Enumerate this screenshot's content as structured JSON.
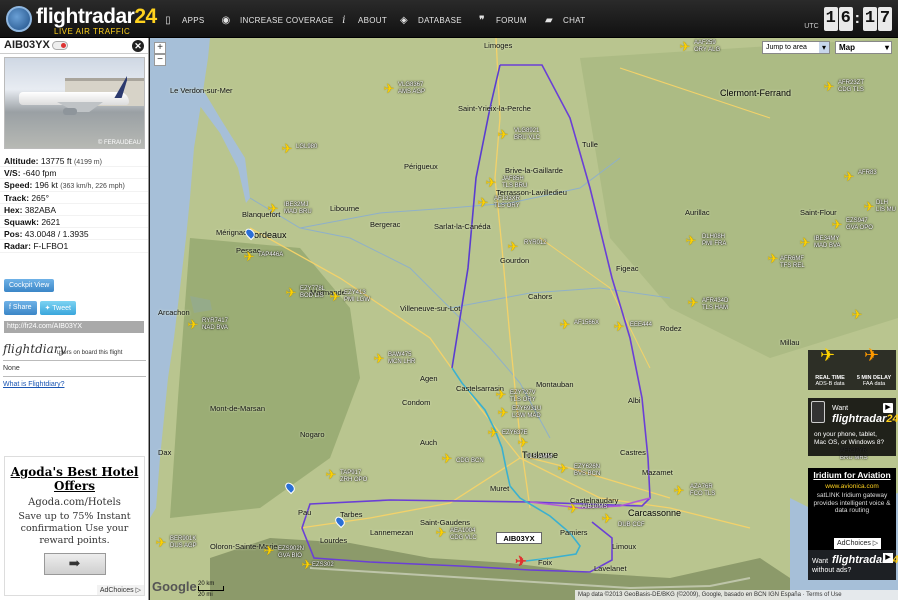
{
  "brand": {
    "name_a": "flightradar",
    "name_b": "24",
    "tagline": "LIVE AIR TRAFFIC"
  },
  "nav": [
    {
      "label": "APPS",
      "icon": "phone-icon"
    },
    {
      "label": "INCREASE COVERAGE",
      "icon": "eye-icon"
    },
    {
      "label": "ABOUT",
      "icon": "info-icon"
    },
    {
      "label": "DATABASE",
      "icon": "database-icon"
    },
    {
      "label": "FORUM",
      "icon": "quote-icon"
    },
    {
      "label": "CHAT",
      "icon": "chat-icon"
    }
  ],
  "clock": {
    "label": "UTC",
    "h1": "1",
    "h2": "6",
    "m1": "1",
    "m2": "7"
  },
  "flight": {
    "callsign": "AIB03YX",
    "photo_credit": "© FERAUDEAU",
    "altitude_label": "Altitude:",
    "altitude": "13775 ft",
    "altitude_m": "(4199 m)",
    "vs_label": "V/S:",
    "vs": "-640 fpm",
    "speed_label": "Speed:",
    "speed": "196 kt",
    "speed_sub": "(363 km/h, 226 mph)",
    "track_label": "Track:",
    "track": "265°",
    "hex_label": "Hex:",
    "hex": "382ABA",
    "squawk_label": "Squawk:",
    "squawk": "2621",
    "pos_label": "Pos:",
    "pos": "43.0048 / 1.3935",
    "radar_label": "Radar:",
    "radar": "F-LFBO1",
    "cockpit_label": "Cockpit View",
    "share_label": "f Share",
    "tweet_label": "Tweet",
    "shortlink": "http://fr24.com/AIB03YX"
  },
  "flightdiary": {
    "logo": "flightdiary",
    "caption": "users on board this flight",
    "none": "None",
    "what": "What is Flightdiary?"
  },
  "ad": {
    "title": "Agoda's Best Hotel Offers",
    "url": "Agoda.com/Hotels",
    "body": "Save up to 75% Instant confirmation Use your reward points.",
    "button": "➡",
    "choices": "AdChoices ▷"
  },
  "map": {
    "jump_label": "Jump to area",
    "type_label": "Map",
    "selected_tag": "AIB03YX",
    "google": "Google",
    "scale_a": "20 km",
    "scale_b": "20 mi",
    "attribution": "Map data ©2013 GeoBasis-DE/BKG (©2009), Google, basado en BCN IGN España · Terms of Use",
    "cities": [
      {
        "n": "Limoges",
        "c": "city"
      },
      {
        "n": "Bordeaux",
        "c": "big"
      },
      {
        "n": "Toulouse",
        "c": "big"
      },
      {
        "n": "Clermont-Ferrand",
        "c": "big"
      },
      {
        "n": "Brive-la-Gaillarde",
        "c": "city"
      },
      {
        "n": "Périgueux",
        "c": "city"
      },
      {
        "n": "Montauban",
        "c": "city"
      },
      {
        "n": "Tarbes",
        "c": "city"
      },
      {
        "n": "Pau",
        "c": "city"
      },
      {
        "n": "Cahors",
        "c": "city"
      },
      {
        "n": "Rodez",
        "c": "city"
      },
      {
        "n": "Albi",
        "c": "city"
      },
      {
        "n": "Castres",
        "c": "city"
      },
      {
        "n": "Foix",
        "c": "city"
      },
      {
        "n": "Aurillac",
        "c": "city"
      },
      {
        "n": "Figeac",
        "c": "city"
      },
      {
        "n": "Mérignac",
        "c": "city"
      },
      {
        "n": "Arcachon",
        "c": "city"
      },
      {
        "n": "Agen",
        "c": "city"
      },
      {
        "n": "Auch",
        "c": "city"
      },
      {
        "n": "Mazamet",
        "c": "city"
      },
      {
        "n": "Lourdes",
        "c": "city"
      },
      {
        "n": "Carcassonne",
        "c": "city"
      },
      {
        "n": "Castelnaudary",
        "c": "city"
      },
      {
        "n": "Gourdon",
        "c": "city"
      },
      {
        "n": "Marmande",
        "c": "city"
      },
      {
        "n": "Bergerac",
        "c": "city"
      },
      {
        "n": "Sarlat-la-Canéda",
        "c": "city"
      },
      {
        "n": "Limoux",
        "c": "city"
      },
      {
        "n": "Millau",
        "c": "city"
      },
      {
        "n": "Saint-Flour",
        "c": "city"
      },
      {
        "n": "Tulle",
        "c": "city"
      },
      {
        "n": "Villeneuve-sur-Lot",
        "c": "city"
      },
      {
        "n": "Castelsarrasin",
        "c": "city"
      },
      {
        "n": "Lannemezan",
        "c": "city"
      },
      {
        "n": "Pamiers",
        "c": "city"
      },
      {
        "n": "Lavelanet",
        "c": "city"
      },
      {
        "n": "Saint-Gaudens",
        "c": "city"
      },
      {
        "n": "Muret",
        "c": "city"
      },
      {
        "n": "Condom",
        "c": "city"
      },
      {
        "n": "Dax",
        "c": "city"
      },
      {
        "n": "Mont-de-Marsan",
        "c": "city"
      },
      {
        "n": "Nogaro",
        "c": "city"
      },
      {
        "n": "Blanquefort",
        "c": "city"
      },
      {
        "n": "Pessac",
        "c": "city"
      },
      {
        "n": "Libourne",
        "c": "city"
      },
      {
        "n": "Saint-Yrieix-la-Perche",
        "c": "city"
      },
      {
        "n": "Terrasson-Lavilledieu",
        "c": "city"
      },
      {
        "n": "Le Verdon-sur-Mer",
        "c": "city"
      },
      {
        "n": "Oloron-Sainte-Marie",
        "c": "city"
      }
    ],
    "planes": [
      {
        "lbl": "VLG8367\nAMS AGP"
      },
      {
        "lbl": "AAF259\nORY ALG"
      },
      {
        "lbl": "AFR23ZT\nCDG TLS"
      },
      {
        "lbl": "LGL980"
      },
      {
        "lbl": "VLG8921\nBRU VLC"
      },
      {
        "lbl": "JAF85H\nTLS BRU"
      },
      {
        "lbl": "AF133XR\nTLS ORY"
      },
      {
        "lbl": "IBE32MJ\nMAD BRU"
      },
      {
        "lbl": "RYR012"
      },
      {
        "lbl": "DLH08H\nPMI FRA"
      },
      {
        "lbl": "IBE34MY\nMAD BVA"
      },
      {
        "lbl": "EZS947\nGVA OPO"
      },
      {
        "lbl": "TAP446A"
      },
      {
        "lbl": "EZY778L\nBOD LIS"
      },
      {
        "lbl": "EZY413\nPMI LGW"
      },
      {
        "lbl": "AFR434D\nTLS HAM"
      },
      {
        "lbl": "RYR7417\nNAD BVA"
      },
      {
        "lbl": "AF1566X"
      },
      {
        "lbl": "EEE444"
      },
      {
        "lbl": "BAW475\nMCN LHR"
      },
      {
        "lbl": "EZY727V\nTLS ORY"
      },
      {
        "lbl": "EZY6931U\nLGW MAD"
      },
      {
        "lbl": "EZY637E"
      },
      {
        "lbl": "TAP917\nZRH OPO"
      },
      {
        "lbl": "CDG BCN"
      },
      {
        "lbl": "EZY626N\nBVS BCN"
      },
      {
        "lbl": "AZA76R\nFCO TLS"
      },
      {
        "lbl": "AIB10MS"
      },
      {
        "lbl": "AEA1004\nCDG VLC"
      },
      {
        "lbl": "DUB CCF"
      },
      {
        "lbl": "BER901K\nDUS AGP"
      },
      {
        "lbl": "EZS902N\nGVA BIO"
      },
      {
        "lbl": "EZS302"
      },
      {
        "lbl": "AFR37YR\nBRU MRS"
      },
      {
        "lbl": "TLS AMM"
      },
      {
        "lbl": "AFR6MF\nTFS REL"
      },
      {
        "lbl": "DLH\nLIS MU"
      },
      {
        "lbl": "AFR83"
      }
    ]
  },
  "promo": {
    "realtime_title": "REAL TIME",
    "realtime_sub": "ADS-B data",
    "delay_title": "5 MIN DELAY",
    "delay_sub": "FAA data",
    "apps_want": "Want",
    "apps_name_a": "flightradar",
    "apps_name_b": "24",
    "apps_line1": "on your phone, tablet,",
    "apps_line2": "Mac OS, or Windows 8?",
    "iridium_title": "Iridium for Aviation",
    "iridium_url": "www.avionica.com",
    "iridium_desc": "satLINK Iridium gateway provides intelligent voice & data routing",
    "adchoices": "AdChoices ▷",
    "adfree_want": "Want",
    "adfree_name_a": "flightradar",
    "adfree_name_b": "24",
    "adfree_without": "without ads?"
  },
  "colors": {
    "track_purple": "#6a3fd6",
    "track_magenta": "#b15ad8",
    "track_cyan": "#3ab0d0",
    "plane": "#ffd200"
  }
}
